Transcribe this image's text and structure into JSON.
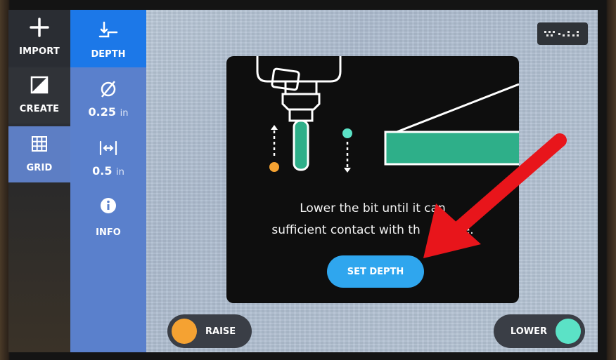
{
  "sidebar_primary": {
    "import_label": "IMPORT",
    "create_label": "CREATE",
    "grid_label": "GRID"
  },
  "sidebar_settings": {
    "depth_label": "DEPTH",
    "bit_diameter_value": "0.25",
    "bit_diameter_unit": "in",
    "grid_spacing_value": "0.5",
    "grid_spacing_unit": "in",
    "info_label": "INFO"
  },
  "dialog": {
    "message_line1": "Lower the bit until it can",
    "message_line2": "sufficient contact with th",
    "message_line2_end": "e.",
    "button_label": "SET DEPTH"
  },
  "controls": {
    "raise_label": "RAISE",
    "lower_label": "LOWER"
  },
  "colors": {
    "accent_blue": "#1c78e8",
    "raise_dot": "#f5a232",
    "lower_dot": "#5be2c6",
    "annotation_arrow": "#e8151b"
  }
}
